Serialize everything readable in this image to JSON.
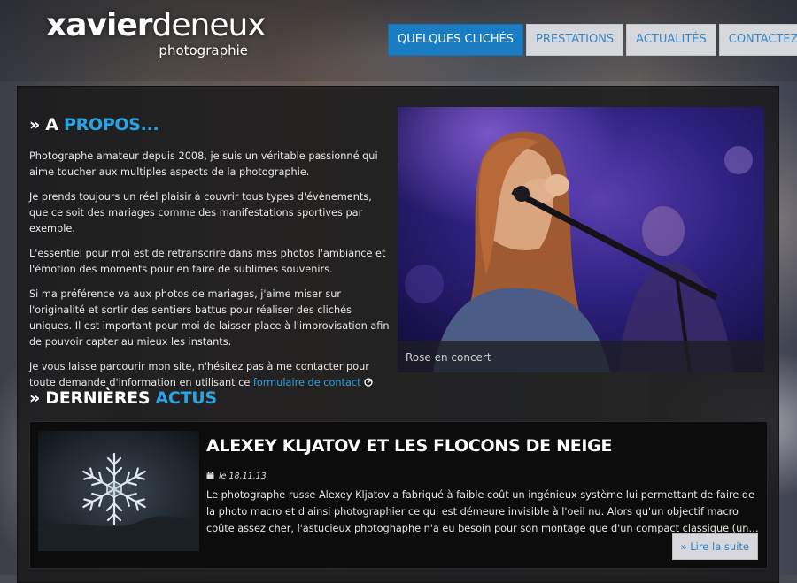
{
  "brand": {
    "name_bold": "xavier",
    "name_light": "deneux",
    "tagline": "photographie"
  },
  "nav": {
    "items": [
      {
        "label": "QUELQUES CLICHÉS",
        "active": true
      },
      {
        "label": "PRESTATIONS",
        "active": false
      },
      {
        "label": "ACTUALITÉS",
        "active": false
      },
      {
        "label": "CONTACTEZ-MOI",
        "active": false
      }
    ]
  },
  "about": {
    "heading_prefix": "» A ",
    "heading_accent": "PROPOS...",
    "paragraphs": [
      "Photographe amateur depuis 2008, je suis un véritable passionné qui aime toucher aux multiples aspects de la photographie.",
      "Je prends toujours un réel plaisir à couvrir tous types d'évènements, que ce soit des mariages comme des manifestations sportives par exemple.",
      "L'essentiel pour moi est de retranscrire dans mes photos l'ambiance et l'émotion des moments pour en faire de sublimes souvenirs.",
      "Si ma préférence va aux photos de mariages, j'aime miser sur l'originalité et sortir des sentiers battus pour réaliser des clichés uniques. Il est important pour moi de laisser place à l'improvisation afin de pouvoir capter au mieux les instants."
    ],
    "last_paragraph_text": "Je vous laisse parcourir mon site, n'hésitez pas à me contacter pour toute demande d'information en utilisant ce ",
    "contact_link_label": "formulaire de contact"
  },
  "featured_photo": {
    "caption": "Rose en concert"
  },
  "news": {
    "heading_prefix": "» DERNIÈRES ",
    "heading_accent": "ACTUS",
    "article": {
      "title": "ALEXEY KLJATOV ET LES FLOCONS DE NEIGE",
      "date": "le 18.11.13",
      "excerpt": "Le photographe russe Alexey Kljatov a fabriqué à faible coût un ingénieux système lui permettant de faire de la photo macro et d'ainsi photographier ce qui est démeure invisible à l'oeil nu. Alors qu'un objectif macro coûte assez cher, l'astucieux photoghaphe n'a eu besoin pour son montage que d'un compact classique (un…",
      "read_more_label": "» Lire la suite"
    }
  },
  "colors": {
    "accent": "#2aa3e3",
    "nav_active": "#1a7cc2",
    "nav_idle": "#d6d8db"
  }
}
